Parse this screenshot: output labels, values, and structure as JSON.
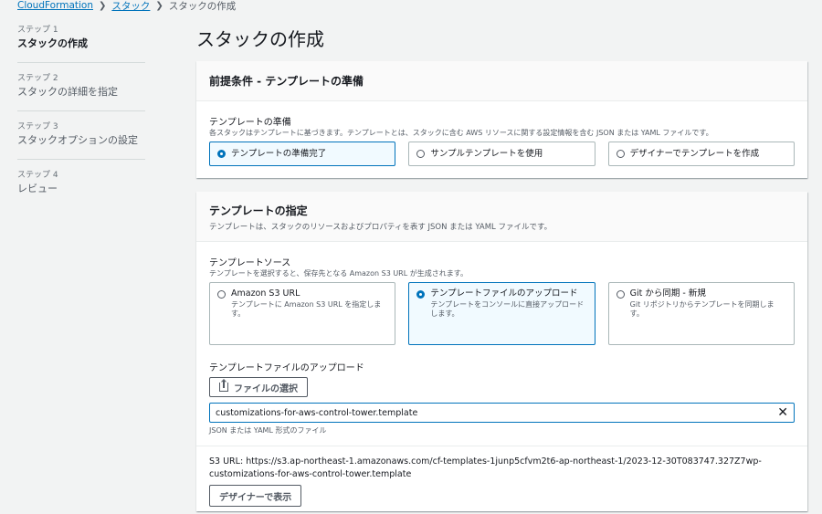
{
  "breadcrumb": {
    "items": [
      "CloudFormation",
      "スタック",
      "スタックの作成"
    ]
  },
  "steps": [
    {
      "num": "ステップ 1",
      "label": "スタックの作成",
      "active": true
    },
    {
      "num": "ステップ 2",
      "label": "スタックの詳細を指定",
      "active": false
    },
    {
      "num": "ステップ 3",
      "label": "スタックオプションの設定",
      "active": false
    },
    {
      "num": "ステップ 4",
      "label": "レビュー",
      "active": false
    }
  ],
  "page_title": "スタックの作成",
  "prereq": {
    "title": "前提条件 - テンプレートの準備",
    "field_label": "テンプレートの準備",
    "field_desc": "各スタックはテンプレートに基づきます。テンプレートとは、スタックに含む AWS リソースに関する設定情報を含む JSON または YAML ファイルです。",
    "options": [
      {
        "label": "テンプレートの準備完了",
        "selected": true
      },
      {
        "label": "サンプルテンプレートを使用",
        "selected": false
      },
      {
        "label": "デザイナーでテンプレートを作成",
        "selected": false
      }
    ]
  },
  "template_spec": {
    "title": "テンプレートの指定",
    "desc": "テンプレートは、スタックのリソースおよびプロパティを表す JSON または YAML ファイルです。",
    "source_label": "テンプレートソース",
    "source_desc": "テンプレートを選択すると、保存先となる Amazon S3 URL が生成されます。",
    "sources": [
      {
        "label": "Amazon S3 URL",
        "desc": "テンプレートに Amazon S3 URL を指定します。",
        "selected": false
      },
      {
        "label": "テンプレートファイルのアップロード",
        "desc": "テンプレートをコンソールに直接アップロードします。",
        "selected": true
      },
      {
        "label": "Git から同期 - 新規",
        "desc": "Git リポジトリからテンプレートを同期します。",
        "selected": false
      }
    ],
    "upload_label": "テンプレートファイルのアップロード",
    "choose_file_button": "ファイルの選択",
    "file_name": "customizations-for-aws-control-tower.template",
    "file_constraint": "JSON または YAML 形式のファイル",
    "s3_url_label": "S3 URL:",
    "s3_url": "https://s3.ap-northeast-1.amazonaws.com/cf-templates-1junp5cfvm2t6-ap-northeast-1/2023-12-30T083747.327Z7wp-customizations-for-aws-control-tower.template",
    "designer_button": "デザイナーで表示"
  },
  "colors": {
    "accent": "#0073bb",
    "background": "#f2f3f3"
  }
}
